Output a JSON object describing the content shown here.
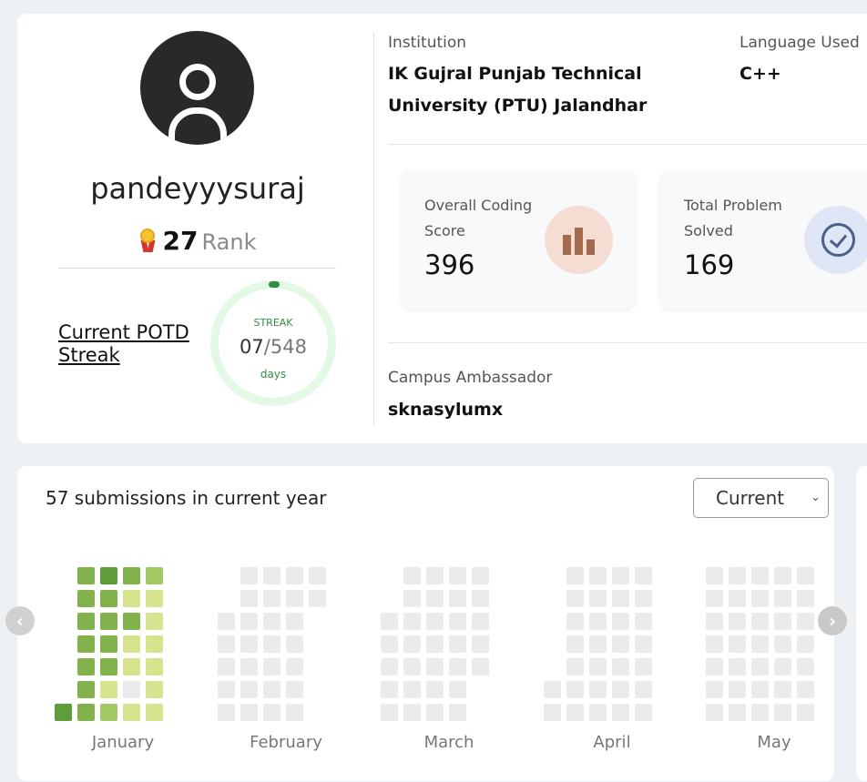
{
  "profile": {
    "username": "pandeyyysuraj",
    "rank_number": "27",
    "rank_word": "Rank",
    "potd_link": "Current POTD Streak",
    "streak": {
      "label": "STREAK",
      "current": "07",
      "total": "/548",
      "unit": "days",
      "progress": 0.013
    }
  },
  "info": {
    "institution_label": "Institution",
    "institution_value": "IK Gujral Punjab Technical University (PTU) Jalandhar",
    "language_label": "Language Used",
    "language_value": "C++",
    "campus_label": "Campus Ambassador",
    "campus_value": "sknasylumx"
  },
  "stats": {
    "score": {
      "label": "Overall Coding Score",
      "value": "396",
      "icon": "bar-chart-icon"
    },
    "solved": {
      "label": "Total Problem Solved",
      "value": "169",
      "icon": "check-circle-icon"
    }
  },
  "heatmap": {
    "submissions_text": "57 submissions in current year",
    "year_select": "Current",
    "colors": {
      "empty": "#ebebeb",
      "l1": "#d6e48d",
      "l2": "#a2c864",
      "l3": "#82b24c",
      "l4": "#5f9c3a",
      "l5": "#3f7f2b"
    },
    "months": [
      "January",
      "February",
      "March",
      "April",
      "May"
    ],
    "january_weeks": [
      [
        "",
        "",
        "",
        "",
        "",
        "",
        "l4"
      ],
      [
        "l3",
        "l3",
        "l3",
        "l3",
        "l3",
        "l3",
        "l3"
      ],
      [
        "l4",
        "l3",
        "l3",
        "l3",
        "l3",
        "l1",
        "l2"
      ],
      [
        "l3",
        "l1",
        "l3",
        "l1",
        "l1",
        "empty",
        "l1"
      ],
      [
        "l2",
        "l1",
        "l1",
        "l1",
        "l1",
        "l1",
        "l1"
      ]
    ],
    "nav_prev": "‹",
    "nav_next": "›"
  }
}
